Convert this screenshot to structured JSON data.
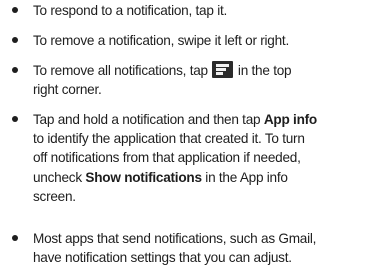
{
  "bullets": [
    {
      "text": "To respond to a notification, tap it."
    },
    {
      "text": "To remove a notification, swipe it left or right."
    },
    {
      "before_icon": "To remove all notifications, tap",
      "icon": "clear-all-notifications-icon",
      "line1_after_icon": "in the top",
      "line2": "right corner."
    },
    {
      "line1_before": "Tap and hold a notification and then tap",
      "line1_bold": "App info",
      "line2": "to identify the application that created it. To turn",
      "line3": "off notifications from that application if needed,",
      "line4_before": "uncheck",
      "line4_bold": "Show notifications",
      "line4_after": "in the App info",
      "line5": "screen."
    },
    {
      "line1": "Most apps that send notifications, such as Gmail,",
      "line2": "have notification settings that you can adjust."
    }
  ]
}
